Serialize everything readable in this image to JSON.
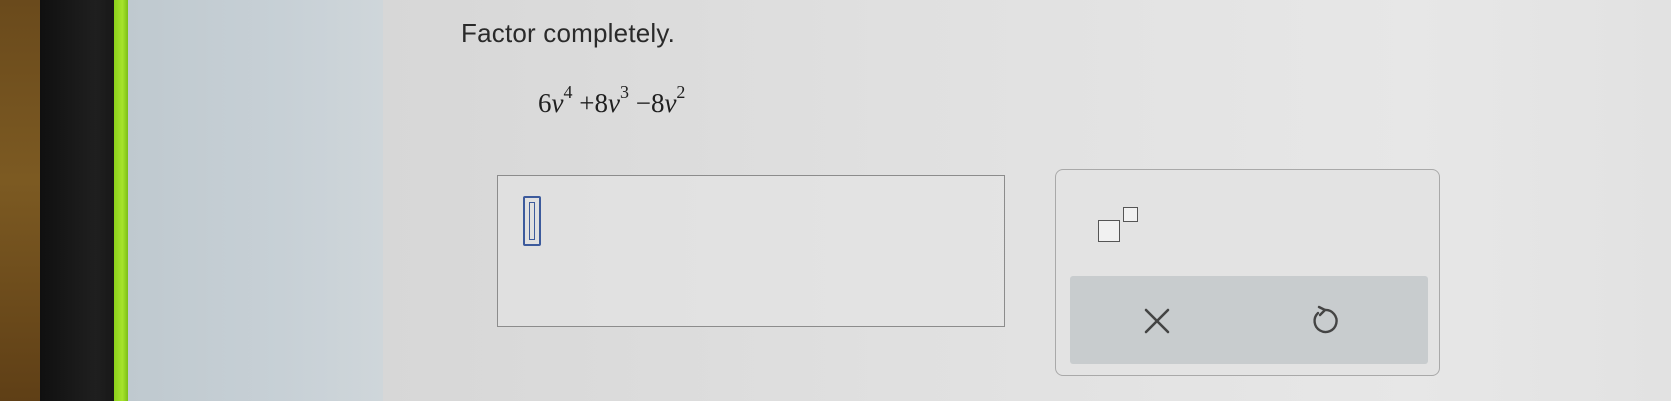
{
  "question": {
    "prompt": "Factor completely.",
    "expression": {
      "term1_coef": "6",
      "term1_var": "v",
      "term1_exp": "4",
      "op1": "+",
      "term2_coef": "8",
      "term2_var": "v",
      "term2_exp": "3",
      "op2": "−",
      "term3_coef": "8",
      "term3_var": "v",
      "term3_exp": "2"
    }
  },
  "answer": {
    "value": ""
  },
  "tools": {
    "exponent_icon": "superscript-template-icon",
    "clear_icon": "x-icon",
    "reset_icon": "undo-circular-arrow-icon"
  },
  "colors": {
    "cursor": "#3c5a9c",
    "accent_green": "#a6e32a",
    "action_bar": "#c8ccce"
  }
}
